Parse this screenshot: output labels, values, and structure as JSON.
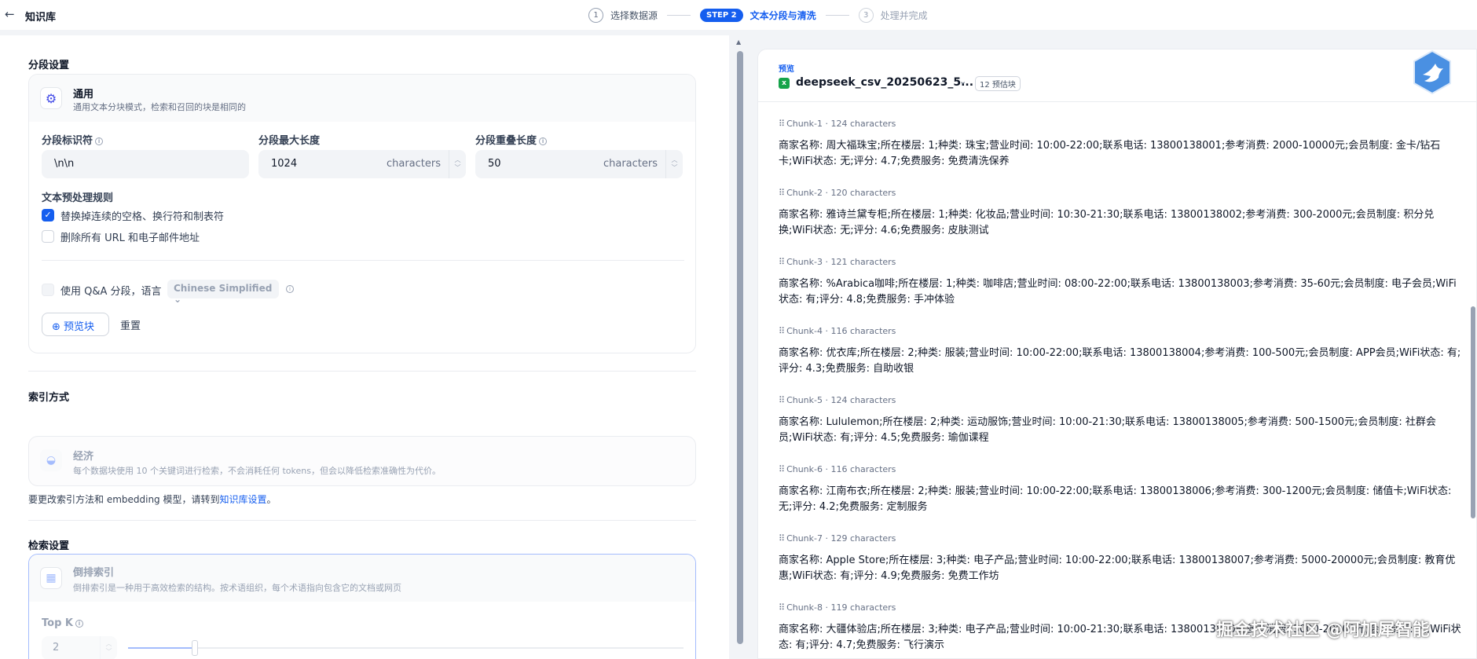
{
  "header": {
    "back_icon": "arrow-left-icon",
    "title": "知识库",
    "steps": [
      {
        "num": "1",
        "label": "选择数据源"
      },
      {
        "badge": "STEP 2",
        "label": "文本分段与清洗"
      },
      {
        "num": "3",
        "label": "处理并完成"
      }
    ]
  },
  "segment": {
    "section_title": "分段设置",
    "mode_name": "通用",
    "mode_desc": "通用文本分块模式，检索和召回的块是相同的",
    "delimiter_label": "分段标识符",
    "delimiter_value": "\\n\\n",
    "max_len_label": "分段最大长度",
    "max_len_value": "1024",
    "max_len_unit": "characters",
    "overlap_label": "分段重叠长度",
    "overlap_value": "50",
    "overlap_unit": "characters",
    "preprocess_title": "文本预处理规则",
    "rule1": "替换掉连续的空格、换行符和制表符",
    "rule1_checked": true,
    "rule2": "删除所有 URL 和电子邮件地址",
    "rule2_checked": false,
    "qa_label": "使用 Q&A 分段，语言",
    "qa_lang": "Chinese Simplified",
    "preview_button": "预览块",
    "reset_button": "重置"
  },
  "index": {
    "section_title": "索引方式",
    "mode_name": "经济",
    "mode_desc": "每个数据块使用 10 个关键词进行检索，不会消耗任何 tokens，但会以降低检索准确性为代价。",
    "note_prefix": "要更改索引方法和 embedding 模型，请转到",
    "note_link": "知识库设置",
    "note_suffix": "。"
  },
  "retrieval": {
    "section_title": "检索设置",
    "mode_name": "倒排索引",
    "mode_desc": "倒排索引是一种用于高效检索的结构。按术语组织，每个术语指向包含它的文档或网页",
    "topk_label": "Top K",
    "topk_value": "2",
    "topk_fill": 0.12
  },
  "preview": {
    "label": "预览",
    "file_icon": "excel-icon",
    "file_name": "deepseek_csv_20250623_5...",
    "count": "12 预估块",
    "chunks": [
      {
        "id": "Chunk-1",
        "chars": "124 characters",
        "text": "商家名称: 周大福珠宝;所在楼层: 1;种类: 珠宝;营业时间: 10:00-22:00;联系电话: 13800138001;参考消费: 2000-10000元;会员制度: 金卡/钻石卡;WiFi状态: 无;评分: 4.7;免费服务: 免费清洗保养"
      },
      {
        "id": "Chunk-2",
        "chars": "120 characters",
        "text": "商家名称: 雅诗兰黛专柜;所在楼层: 1;种类: 化妆品;营业时间: 10:30-21:30;联系电话: 13800138002;参考消费: 300-2000元;会员制度: 积分兑换;WiFi状态: 无;评分: 4.6;免费服务: 皮肤测试"
      },
      {
        "id": "Chunk-3",
        "chars": "121 characters",
        "text": "商家名称: %Arabica咖啡;所在楼层: 1;种类: 咖啡店;营业时间: 08:00-22:00;联系电话: 13800138003;参考消费: 35-60元;会员制度: 电子会员;WiFi状态: 有;评分: 4.8;免费服务: 手冲体验"
      },
      {
        "id": "Chunk-4",
        "chars": "116 characters",
        "text": "商家名称: 优衣库;所在楼层: 2;种类: 服装;营业时间: 10:00-22:00;联系电话: 13800138004;参考消费: 100-500元;会员制度: APP会员;WiFi状态: 有;评分: 4.3;免费服务: 自助收银"
      },
      {
        "id": "Chunk-5",
        "chars": "124 characters",
        "text": "商家名称: Lululemon;所在楼层: 2;种类: 运动服饰;营业时间: 10:00-21:30;联系电话: 13800138005;参考消费: 500-1500元;会员制度: 社群会员;WiFi状态: 有;评分: 4.5;免费服务: 瑜伽课程"
      },
      {
        "id": "Chunk-6",
        "chars": "116 characters",
        "text": "商家名称: 江南布衣;所在楼层: 2;种类: 服装;营业时间: 10:00-22:00;联系电话: 13800138006;参考消费: 300-1200元;会员制度: 储值卡;WiFi状态: 无;评分: 4.2;免费服务: 定制服务"
      },
      {
        "id": "Chunk-7",
        "chars": "129 characters",
        "text": "商家名称: Apple Store;所在楼层: 3;种类: 电子产品;营业时间: 10:00-22:00;联系电话: 13800138007;参考消费: 5000-20000元;会员制度: 教育优惠;WiFi状态: 有;评分: 4.9;免费服务: 免费工作坊"
      },
      {
        "id": "Chunk-8",
        "chars": "119 characters",
        "text": "商家名称: 大疆体验店;所在楼层: 3;种类: 电子产品;营业时间: 10:00-21:30;联系电话: 13800138008;参考消费: 3000-20000元;会员制度: 无;WiFi状态: 有;评分: 4.7;免费服务: 飞行演示"
      }
    ]
  },
  "watermark": "掘金技术社区 @阿加犀智能",
  "colors": {
    "accent": "#155eef",
    "check": "#155eef",
    "excel": "#16a34a"
  }
}
